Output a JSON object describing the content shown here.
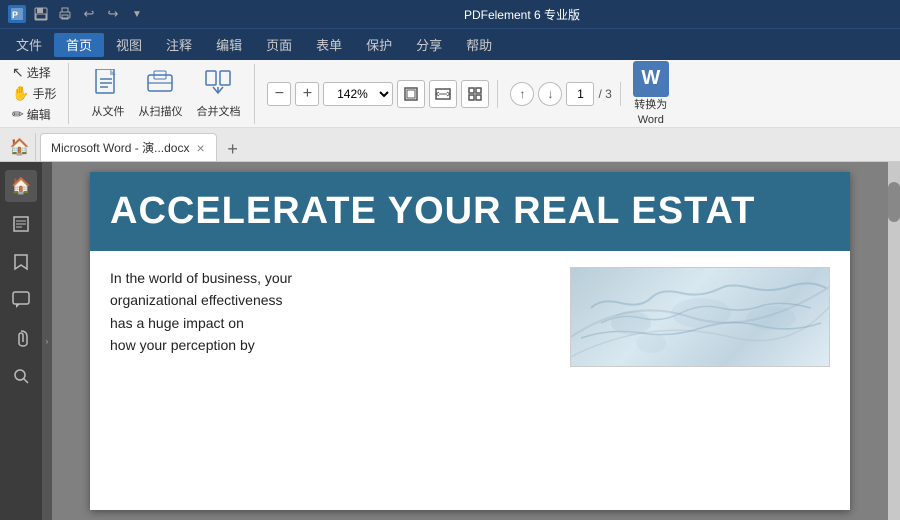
{
  "titlebar": {
    "title": "PDFelement 6 专业版",
    "icons": [
      "save",
      "print"
    ],
    "undo": "↩",
    "redo": "↪"
  },
  "menubar": {
    "active": "首页",
    "items": [
      "文件",
      "首页",
      "视图",
      "注释",
      "编辑",
      "页面",
      "表单",
      "保护",
      "分享",
      "帮助"
    ]
  },
  "toolbar": {
    "tools": [
      {
        "label": "选择",
        "icon": "↖"
      },
      {
        "label": "手形",
        "icon": "✋"
      },
      {
        "label": "编辑",
        "icon": "✏"
      }
    ],
    "from_file": "从文件",
    "from_scanner": "从扫描仪",
    "merge_doc": "合并文档",
    "zoom_out": "−",
    "zoom_in": "+",
    "zoom_value": "142%",
    "fit_page": "⊡",
    "fit_width": "⊞",
    "fullscreen": "⊟",
    "prev_page": "↑",
    "next_page": "↓",
    "current_page": "1",
    "total_pages": "/ 3",
    "convert_label": "转换为",
    "convert_target": "Word"
  },
  "tabs": {
    "home_icon": "🏠",
    "active_tab": "Microsoft Word - 演...docx",
    "add_tab": "+"
  },
  "sidebar": {
    "items": [
      "🏠",
      "☰",
      "🔖",
      "💬",
      "📎",
      "🔍"
    ]
  },
  "document": {
    "title": "ACCELERATE YOUR REAL ESTAT",
    "body_text_1": "In the world of business, your",
    "body_text_2": "organizational effectiveness",
    "body_text_3": "has a huge impact on",
    "body_text_4": "how your perception by"
  }
}
